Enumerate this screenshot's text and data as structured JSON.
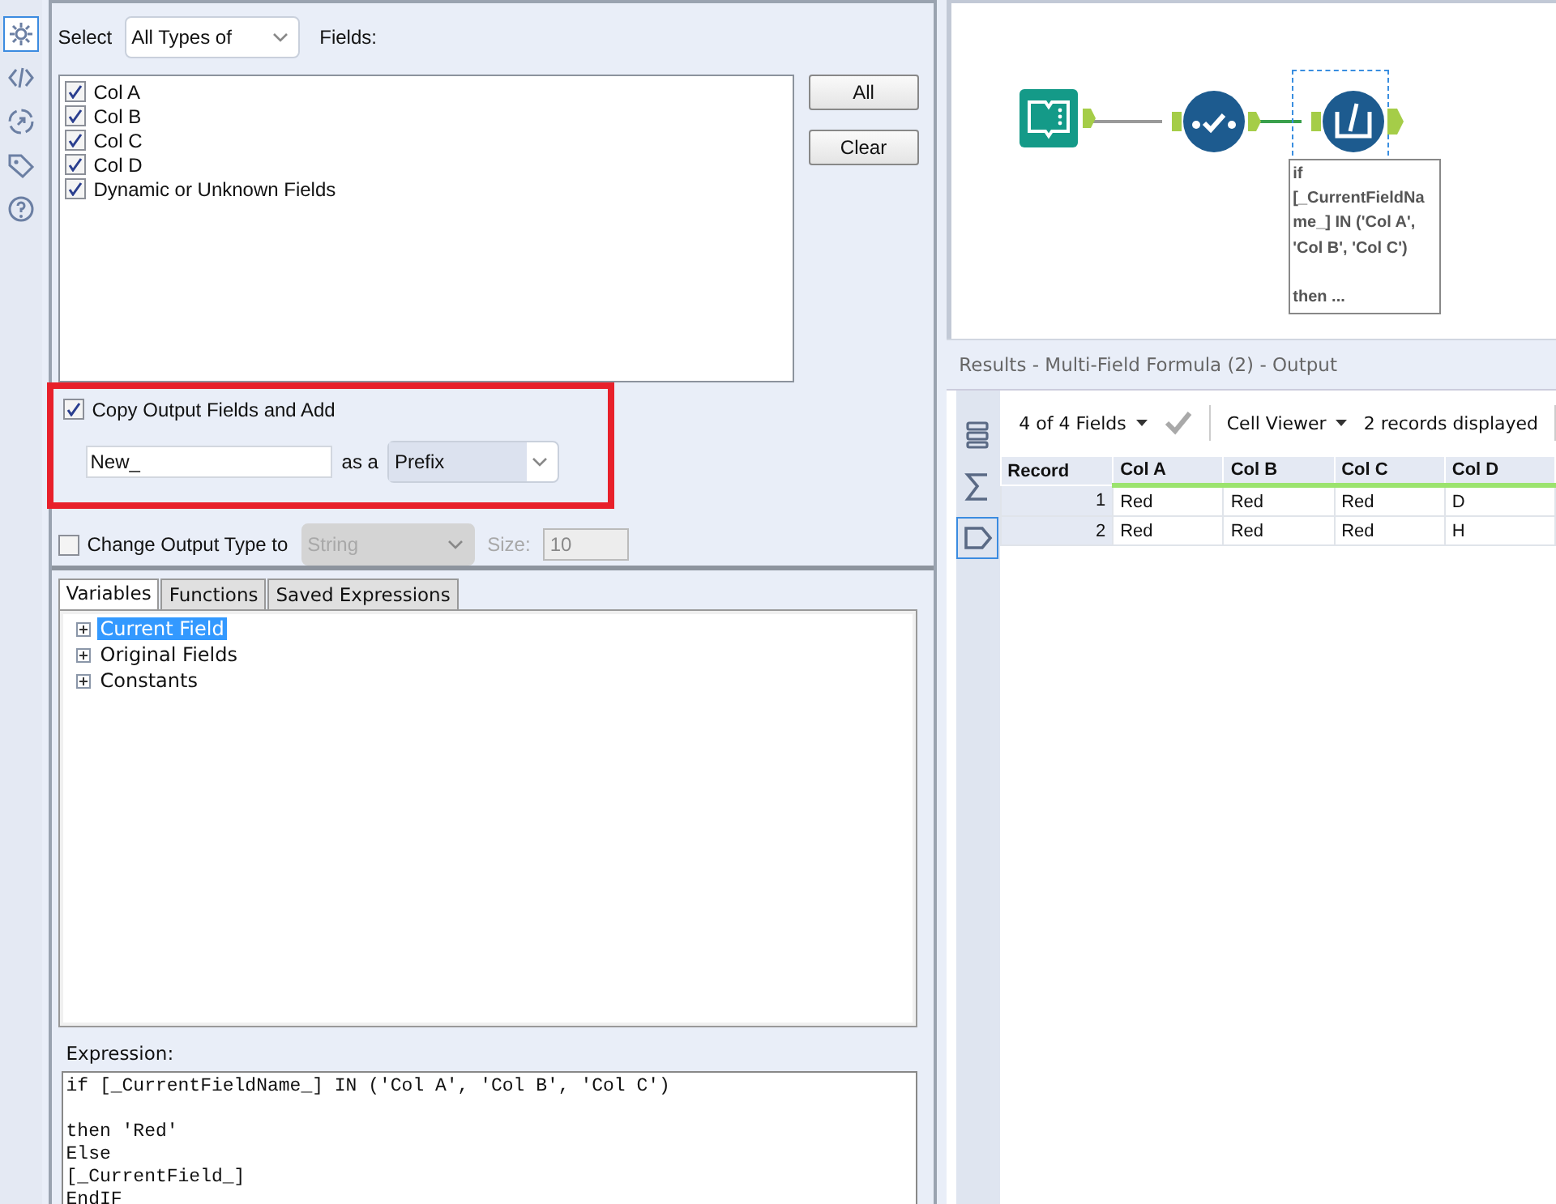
{
  "rail": [
    {
      "kind": "gear",
      "selected": true
    },
    {
      "kind": "code",
      "selected": false
    },
    {
      "kind": "arrow",
      "selected": false
    },
    {
      "kind": "tag",
      "selected": false
    },
    {
      "kind": "help",
      "selected": false
    }
  ],
  "select": {
    "label": "Select",
    "value": "All Types of",
    "fields_label": "Fields:"
  },
  "fields": [
    {
      "label": "Col A",
      "checked": true
    },
    {
      "label": "Col B",
      "checked": true
    },
    {
      "label": "Col C",
      "checked": true
    },
    {
      "label": "Col D",
      "checked": true
    },
    {
      "label": "Dynamic or Unknown Fields",
      "checked": true
    }
  ],
  "buttons": [
    "All",
    "Clear"
  ],
  "copy": {
    "label": "Copy Output Fields and Add",
    "checked": true,
    "value": "New_",
    "as_label": "as a",
    "mode": "Prefix"
  },
  "change_type": {
    "label": "Change Output Type to",
    "checked": false,
    "type": "String",
    "size_label": "Size:",
    "size": "10",
    "disabled": true
  },
  "tabs": [
    {
      "label": "Variables",
      "selected": true
    },
    {
      "label": "Functions",
      "selected": false
    },
    {
      "label": "Saved Expressions",
      "selected": false
    }
  ],
  "tree": [
    {
      "label": "Current Field",
      "expanded": false,
      "selected": true
    },
    {
      "label": "Original Fields",
      "expanded": false,
      "selected": false
    },
    {
      "label": "Constants",
      "expanded": false,
      "selected": false
    }
  ],
  "expression": {
    "label": "Expression:",
    "text": "if [_CurrentFieldName_] IN ('Col A', 'Col B', 'Col C')\n\nthen 'Red'\nElse\n[_CurrentField_]\nEndIF"
  },
  "workflow": {
    "nodes": [
      {
        "kind": "input"
      },
      {
        "kind": "select"
      },
      {
        "kind": "formula",
        "selected": true
      }
    ],
    "annotation": "if\n[_CurrentFieldNa\nme_] IN ('Col A',\n'Col B', 'Col C')\n\nthen ..."
  },
  "results": {
    "title": "Results - Multi-Field Formula (2) - Output",
    "side": [
      {
        "kind": "rows",
        "selected": false
      },
      {
        "kind": "sigma",
        "selected": false
      },
      {
        "kind": "tag",
        "selected": true
      }
    ],
    "fields_menu": "4 of 4 Fields",
    "viewer": "Cell Viewer",
    "count": "2 records displayed",
    "table": {
      "columns": [
        "Record",
        "Col A",
        "Col B",
        "Col C",
        "Col D"
      ],
      "rows": [
        [
          "1",
          "Red",
          "Red",
          "Red",
          "D"
        ],
        [
          "2",
          "Red",
          "Red",
          "Red",
          "H"
        ]
      ]
    }
  }
}
